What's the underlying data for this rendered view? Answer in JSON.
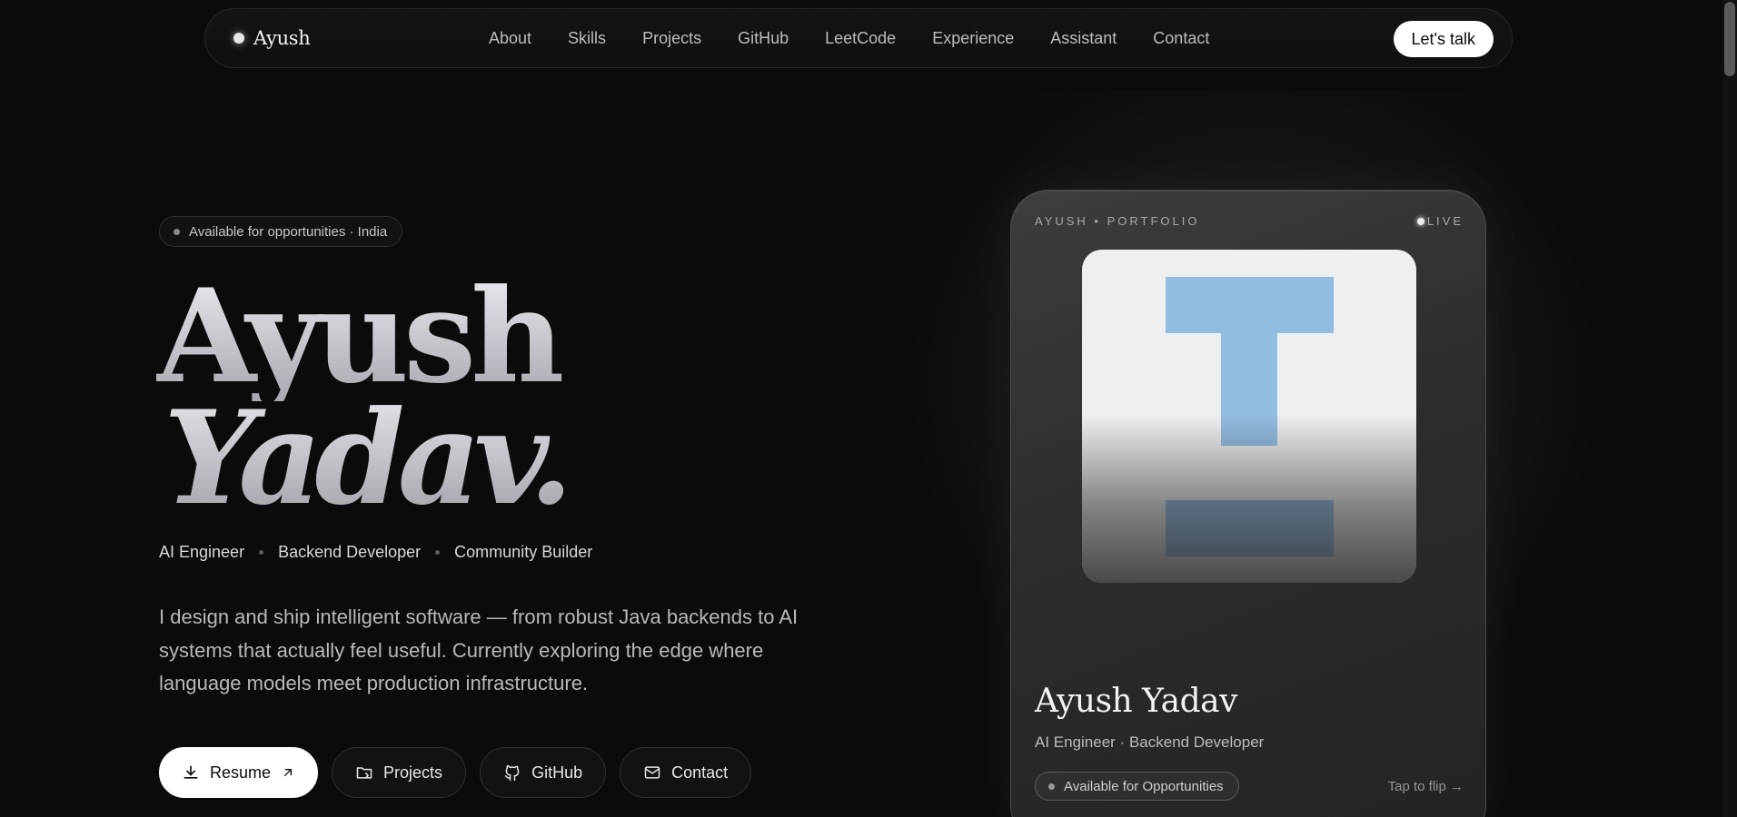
{
  "nav": {
    "brand": "Ayush",
    "links": [
      "About",
      "Skills",
      "Projects",
      "GitHub",
      "LeetCode",
      "Experience",
      "Assistant",
      "Contact"
    ],
    "cta": "Let's talk"
  },
  "hero": {
    "badge": "Available for opportunities · India",
    "name_line1": "Ayush",
    "name_line2": "Yadav.",
    "roles": [
      "AI Engineer",
      "Backend Developer",
      "Community Builder"
    ],
    "intro": "I design and ship intelligent software — from robust Java backends to AI systems that actually feel useful. Currently exploring the edge where language models meet production infrastructure.",
    "buttons": {
      "resume": "Resume",
      "projects": "Projects",
      "github": "GitHub",
      "contact": "Contact"
    }
  },
  "card": {
    "header": "AYUSH • PORTFOLIO",
    "live": "LIVE",
    "name": "Ayush Yadav",
    "role": "AI Engineer · Backend Developer",
    "status": "Available for Opportunities",
    "flip": "Tap to flip →",
    "image_icon": "broken-image-placeholder-icon"
  },
  "colors": {
    "background": "#0b0b0b",
    "placeholder_blue": "#92bde2",
    "accent_white": "#ffffff"
  }
}
